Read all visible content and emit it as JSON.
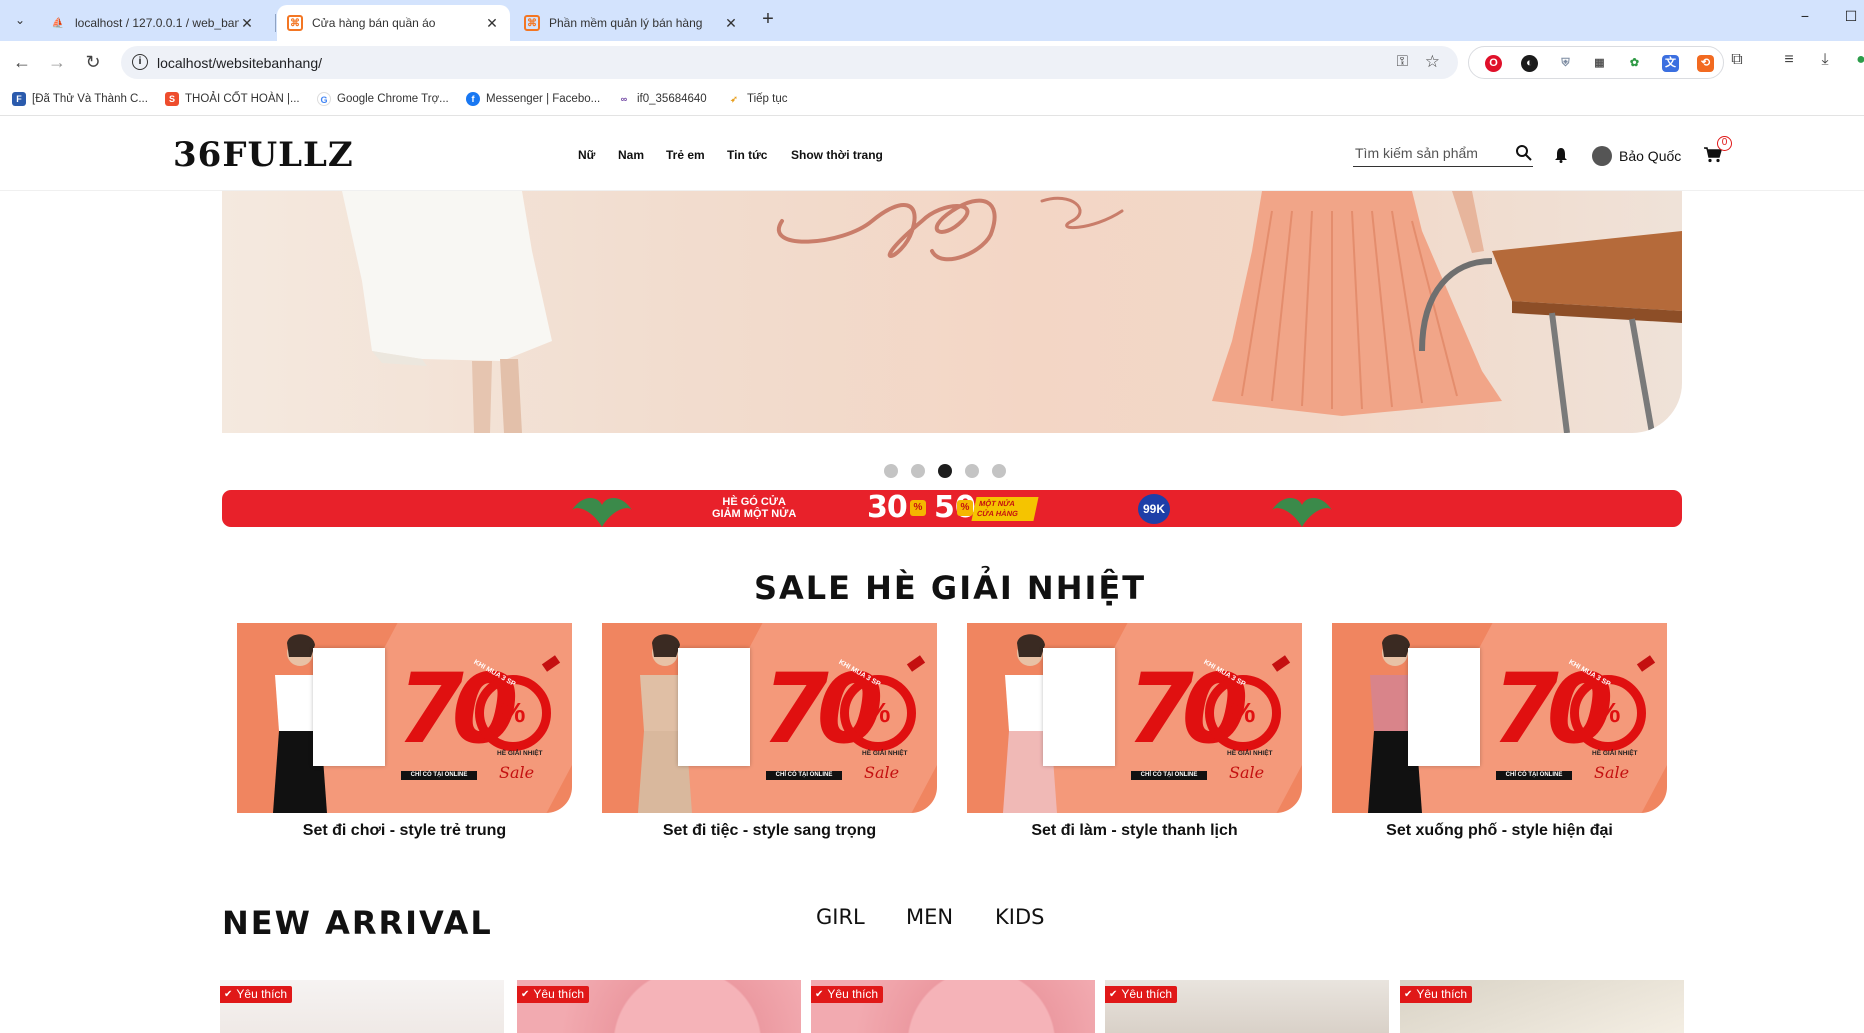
{
  "browser": {
    "tabs": [
      {
        "title": "localhost / 127.0.0.1 / web_banhang",
        "active": false
      },
      {
        "title": "Cửa hàng bán quần áo",
        "active": true
      },
      {
        "title": "Phần mềm quản lý bán hàng",
        "active": false
      }
    ],
    "new_tab": "+",
    "minimize": "−",
    "maximize": "☐",
    "close": "✕",
    "url": "localhost/websitebanhang/",
    "bookmarks": [
      "[Đã Thử Và Thành C...",
      "THOẢI CỐT HOÀN |...",
      "Google Chrome Trợ...",
      "Messenger | Facebo...",
      "if0_35684640",
      "Tiếp tục"
    ]
  },
  "site": {
    "logo": "36FULLZ",
    "nav": [
      "Nữ",
      "Nam",
      "Trẻ em",
      "Tin tức",
      "Show thời trang"
    ],
    "search_placeholder": "Tìm kiếm sản phẩm",
    "user_name": "Bảo Quốc",
    "cart_count": "0"
  },
  "carousel": {
    "slide_count": 5,
    "active_index": 2
  },
  "promo_strip": {
    "line1": "HÈ GÓ CỬA",
    "line2": "GIẢM MỘT NỬA",
    "n1": "30",
    "n2": "50",
    "pct": "%",
    "sub1": "MỘT NỬA",
    "sub2": "CỬA HÀNG",
    "badge": "99K"
  },
  "sale_section": {
    "title": "SALE HÈ GIẢI NHIỆT",
    "banner_text": {
      "number": "70",
      "percent": "%",
      "condition": "KHI MUA 3 SP",
      "tagline": "HÈ GIẢI NHIỆT",
      "online": "CHỈ CÓ TẠI ONLINE",
      "script": "Sale"
    },
    "cards": [
      {
        "caption": "Set đi chơi - style trẻ trung"
      },
      {
        "caption": "Set đi tiệc - style sang trọng"
      },
      {
        "caption": "Set đi làm - style thanh lịch"
      },
      {
        "caption": "Set xuống phố - style hiện đại"
      }
    ]
  },
  "new_arrival": {
    "title": "NEW ARRIVAL",
    "tabs": [
      "GIRL",
      "MEN",
      "KIDS"
    ],
    "favorite_label": "Yêu thích",
    "products": 5
  },
  "colors": {
    "accent_red": "#e01818",
    "promo_red": "#e8212a",
    "tab_bar": "#d3e3fd",
    "card_orange": "#f08560"
  }
}
